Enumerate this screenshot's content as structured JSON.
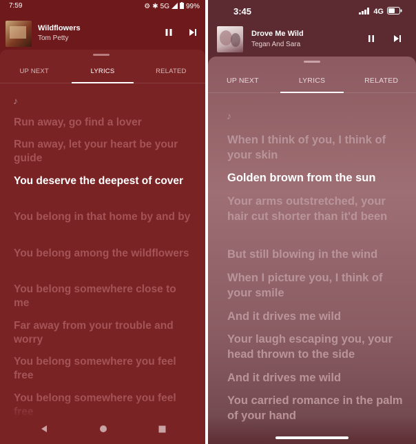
{
  "left": {
    "status": {
      "time": "7:59",
      "network": "5G",
      "battery": "99%"
    },
    "now_playing": {
      "title": "Wildflowers",
      "artist": "Tom Petty"
    },
    "tabs": [
      {
        "label": "UP NEXT",
        "active": false
      },
      {
        "label": "LYRICS",
        "active": true
      },
      {
        "label": "RELATED",
        "active": false
      }
    ],
    "note_icon": "♪",
    "lyrics": [
      {
        "text": "Run away, go find a lover",
        "current": false
      },
      {
        "text": "Run away, let your heart be your guide",
        "current": false
      },
      {
        "text": "You deserve the deepest of cover",
        "current": true
      },
      {
        "text": "You belong in that home by and by",
        "current": false
      },
      {
        "text": "You belong among the wildflowers",
        "current": false
      },
      {
        "text": "You belong somewhere close to me",
        "current": false
      },
      {
        "text": "Far away from your trouble and worry",
        "current": false
      },
      {
        "text": "You belong somewhere you feel free",
        "current": false
      },
      {
        "text": "You belong somewhere you feel free",
        "current": false
      }
    ],
    "nav_icons": [
      "back-icon",
      "home-icon",
      "recents-icon"
    ],
    "colors": {
      "background": "#6e1a1c",
      "sheet": "#7a2325",
      "dim_lyric": "#a45456"
    }
  },
  "right": {
    "status": {
      "time": "3:45",
      "network": "4G"
    },
    "now_playing": {
      "title": "Drove Me Wild",
      "artist": "Tegan And Sara"
    },
    "tabs": [
      {
        "label": "UP NEXT",
        "active": false
      },
      {
        "label": "LYRICS",
        "active": true
      },
      {
        "label": "RELATED",
        "active": false
      }
    ],
    "note_icon": "♪",
    "lyrics": [
      {
        "text": "When I think of you, I think of your skin",
        "current": false
      },
      {
        "text": "Golden brown from the sun",
        "current": true
      },
      {
        "text": "Your arms outstretched, your hair cut shorter than it'd been",
        "current": false
      },
      {
        "text": "But still blowing in the wind",
        "current": false
      },
      {
        "text": "When I picture you, I think of your smile",
        "current": false
      },
      {
        "text": "And it drives me wild",
        "current": false
      },
      {
        "text": "Your laugh escaping you, your head thrown to the side",
        "current": false
      },
      {
        "text": "And it drives me wild",
        "current": false
      },
      {
        "text": "You carried romance in the palm of your hand",
        "current": false
      }
    ],
    "colors": {
      "background": "#5b2b31",
      "sheet": "#9e6f74",
      "dim_lyric": "#b9959a"
    }
  }
}
